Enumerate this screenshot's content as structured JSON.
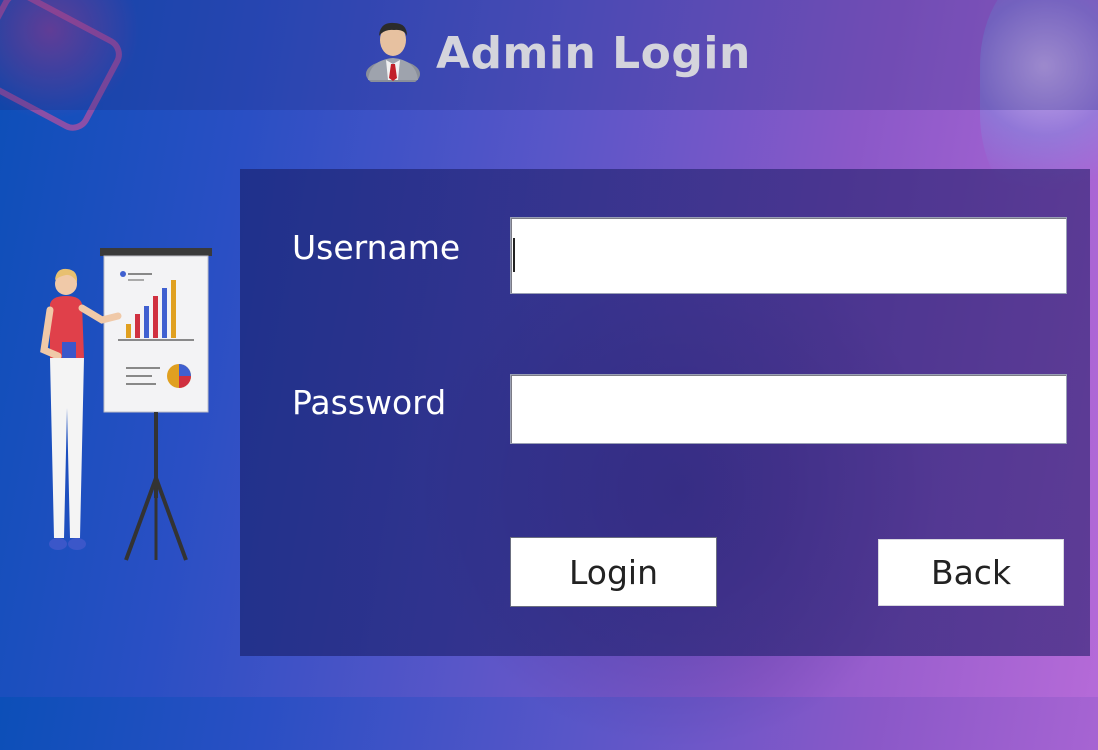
{
  "header": {
    "title": "Admin Login",
    "icon": "admin-user-icon"
  },
  "form": {
    "username_label": "Username",
    "username_value": "",
    "password_label": "Password",
    "password_value": ""
  },
  "buttons": {
    "login_label": "Login",
    "back_label": "Back"
  },
  "illustration": "presenter-with-chart-board",
  "colors": {
    "background_start": "#0c4fb8",
    "background_end": "#b56ad8",
    "title_text": "#d4d4dc",
    "label_text": "#ffffff"
  }
}
